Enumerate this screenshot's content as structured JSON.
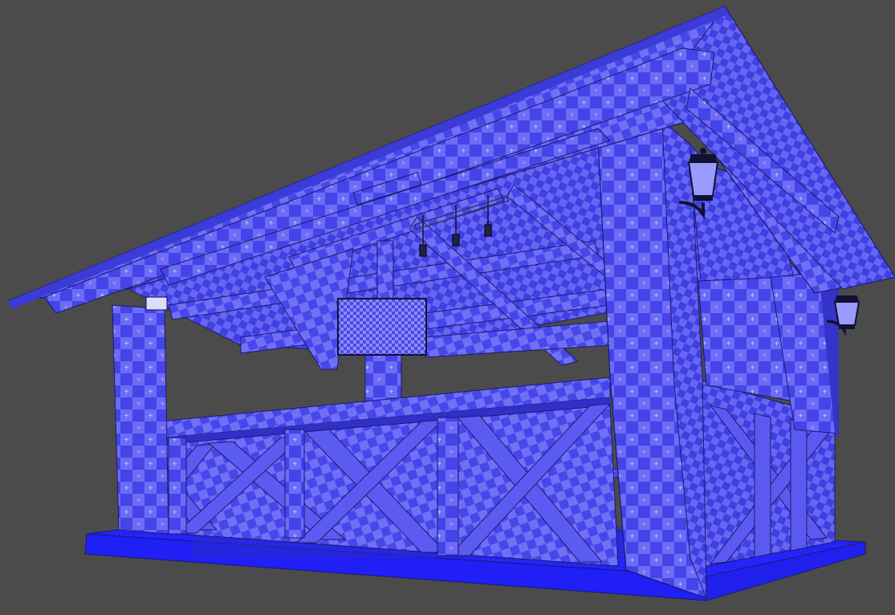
{
  "scene": {
    "background": "#4b4b4b",
    "colors": {
      "checker_light": "#6a6af5",
      "checker_dark": "#4040e6",
      "edge": "#1a1a6e",
      "floor": "#2020ff",
      "fine_checker_light": "#8a8aff",
      "fine_checker_dark": "#3a3ad8",
      "lamp_glass": "#9090ff",
      "lamp_metal": "#111133"
    },
    "objects": [
      "roof",
      "roof-ridge-beam",
      "front-post-left",
      "front-post-right",
      "back-post",
      "rear-posts",
      "railing-top-rail",
      "x-brace-panels",
      "side-railing",
      "floor-deck",
      "hanging-screen",
      "pendant-lights",
      "wall-lantern",
      "ceiling-rafters",
      "interior-benches"
    ]
  }
}
